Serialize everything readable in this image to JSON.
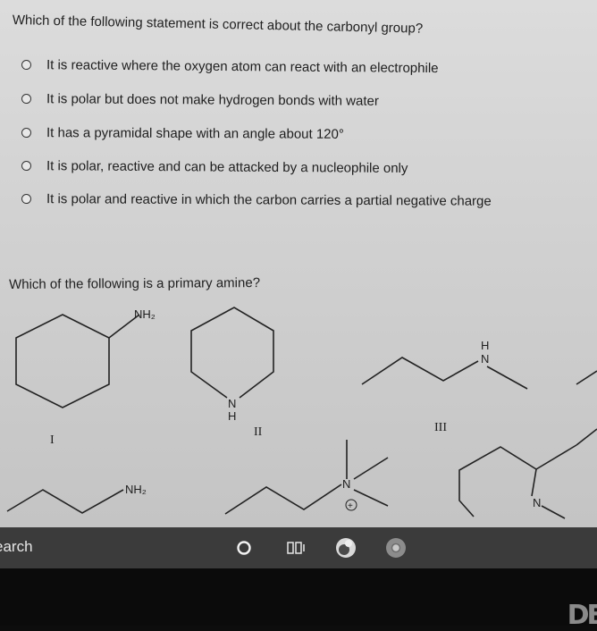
{
  "question1": {
    "text": "Which of the following statement is correct about the carbonyl group?",
    "options": [
      "It is reactive where the oxygen atom can react with an electrophile",
      "It is polar but does not make hydrogen bonds with water",
      "It has a pyramidal shape with an angle about 120°",
      "It is polar, reactive and can be attacked by a nucleophile only",
      "It is polar and reactive in which the carbon carries a partial negative charge"
    ]
  },
  "question2": {
    "text": "Which of the following is a primary amine?",
    "labels": {
      "nh2_top": "NH₂",
      "nh2_bottom": "NH₂",
      "n_ring": "N",
      "h_ring": "H",
      "h_chain": "H",
      "n_chain": "N",
      "n_quat": "N",
      "plus": "+",
      "n_ring2": "N",
      "roman_1": "I",
      "roman_2": "II",
      "roman_3": "III"
    }
  },
  "taskbar": {
    "search_text": "earch"
  },
  "bezel": {
    "logo_text": "DE"
  }
}
